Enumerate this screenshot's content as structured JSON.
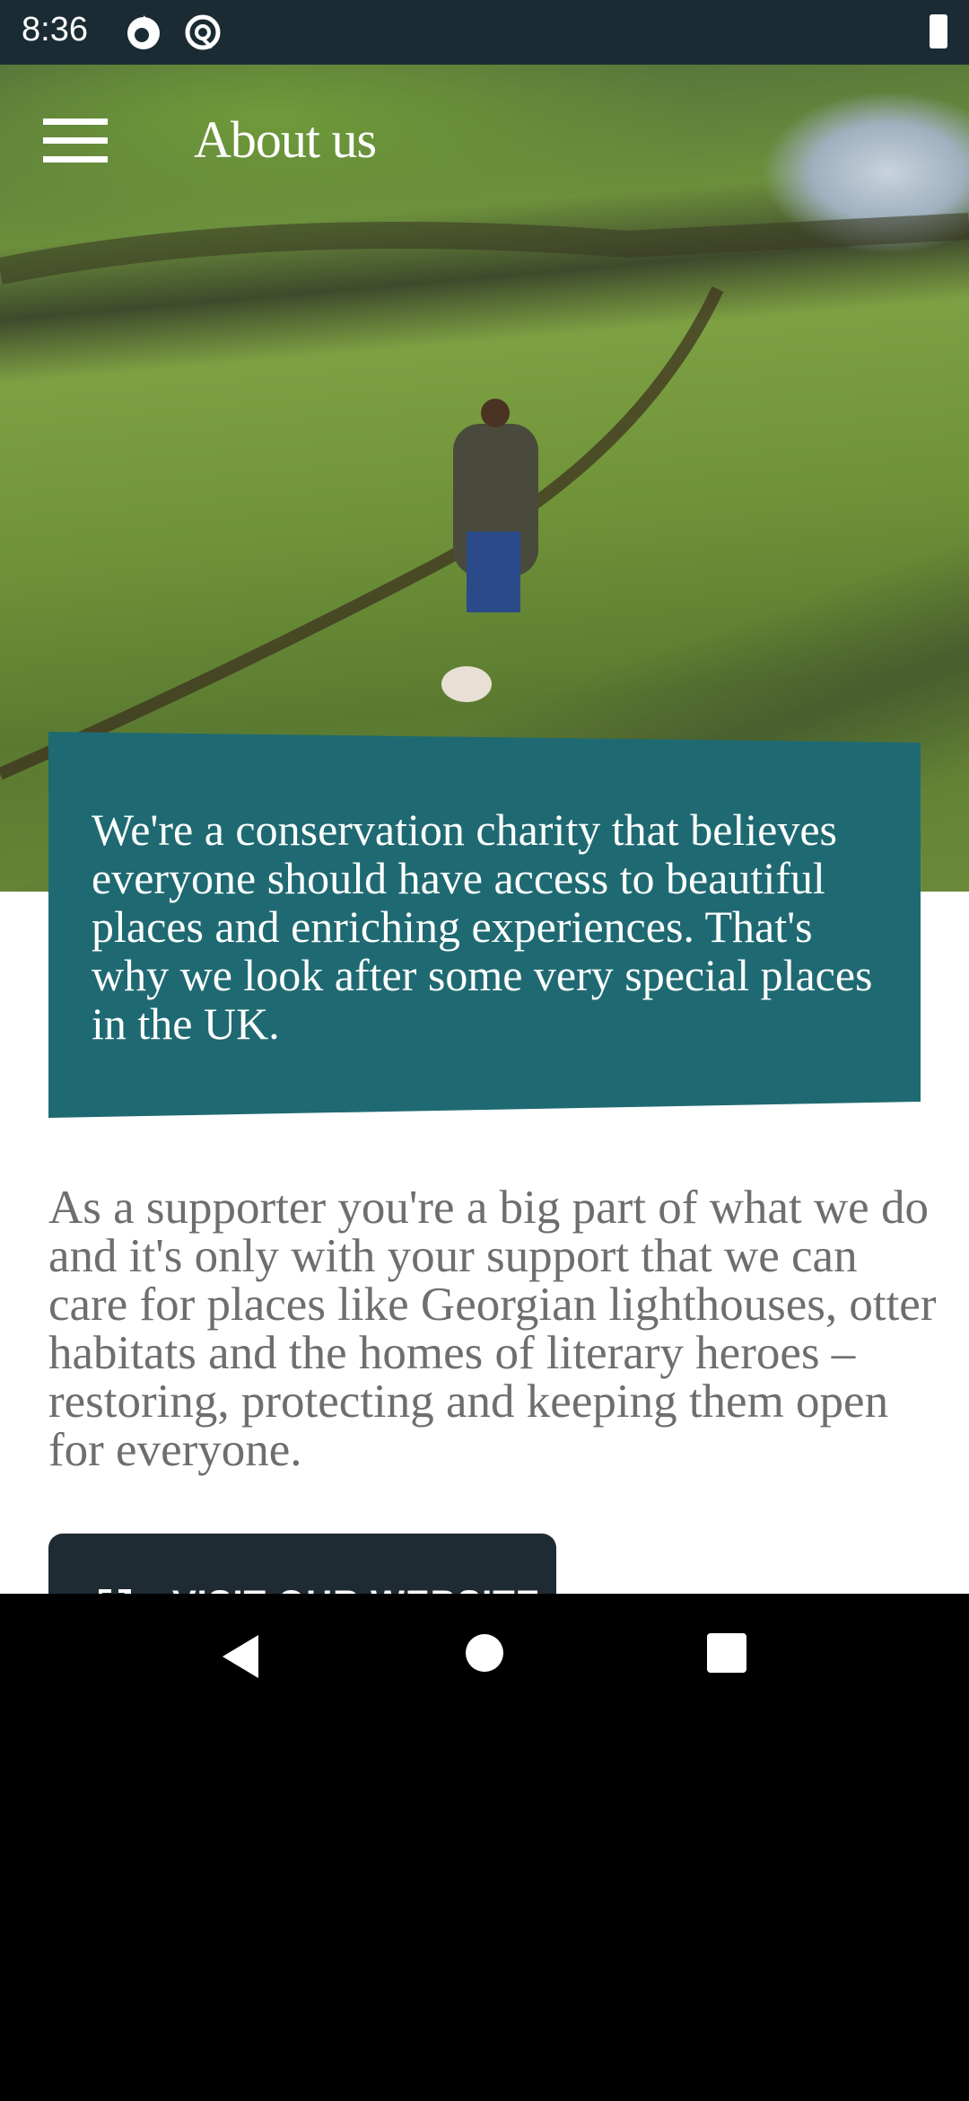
{
  "status": {
    "time": "8:36",
    "icons": [
      "firefox-icon",
      "at-sign-icon",
      "battery-charging-icon"
    ]
  },
  "header": {
    "title": "About us",
    "menu_icon": "hamburger-menu-icon"
  },
  "callout": {
    "text": "We're a conservation charity that believes everyone should have access to beautiful places and enriching experiences. That's why we look after some very special places in the UK.",
    "color": "#1f6a72"
  },
  "body": {
    "text": "As a supporter you're a big part of what we do and it's only with your support that we can care for places like Georgian lighthouses, otter habitats and the homes of literary heroes – restoring, protecting and keeping them open for everyone."
  },
  "button": {
    "label": "VISIT OUR WEBSITE",
    "icon": "external-link-icon"
  },
  "nav": {
    "icons": [
      "back-icon",
      "home-icon",
      "recents-icon"
    ]
  }
}
